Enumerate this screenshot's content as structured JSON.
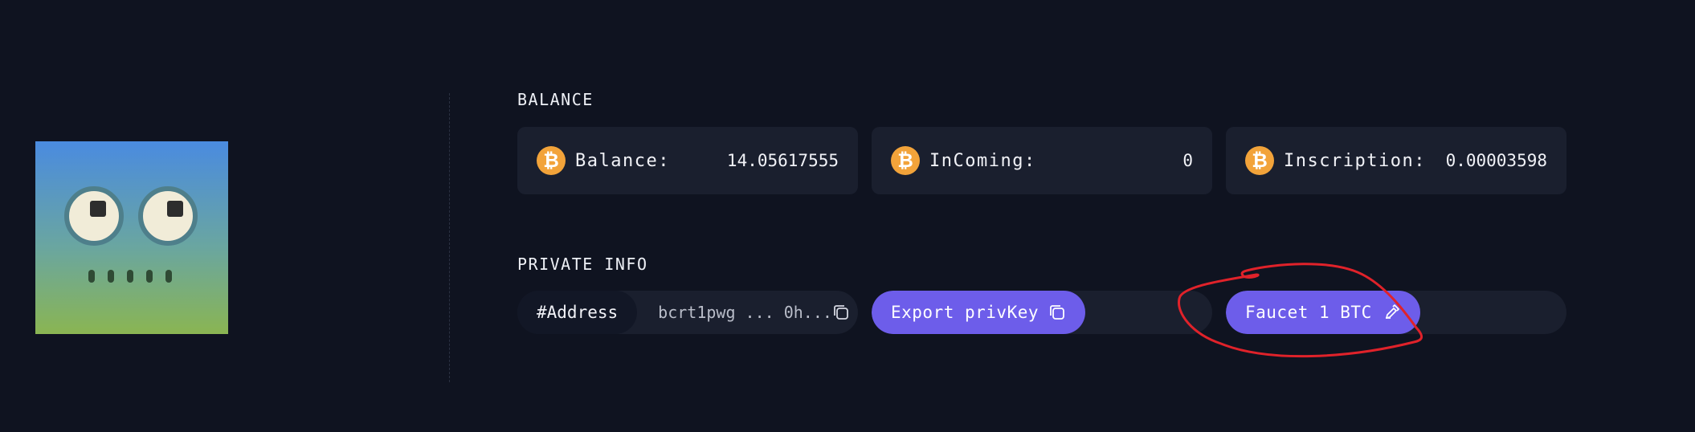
{
  "avatar": {
    "alt": "robot avatar"
  },
  "balance_section": {
    "title": "BALANCE",
    "cards": [
      {
        "label": "Balance:",
        "value": "14.05617555",
        "icon": "bitcoin-icon"
      },
      {
        "label": "InComing:",
        "value": "0",
        "icon": "bitcoin-icon"
      },
      {
        "label": "Inscription:",
        "value": "0.00003598",
        "icon": "bitcoin-icon"
      }
    ]
  },
  "private_section": {
    "title": "PRIVATE INFO",
    "address_tag": "#Address",
    "address_value": "bcrt1pwg ... 0h...",
    "export_label": "Export privKey",
    "faucet_label": "Faucet 1 BTC"
  },
  "colors": {
    "background": "#0f1320",
    "card": "#1a1f2e",
    "accent": "#6d5dea",
    "bitcoin": "#f2a33a",
    "annotation": "#e0222a"
  },
  "icons": {
    "bitcoin": "bitcoin-icon",
    "copy": "copy-icon",
    "faucet": "faucet-icon"
  }
}
